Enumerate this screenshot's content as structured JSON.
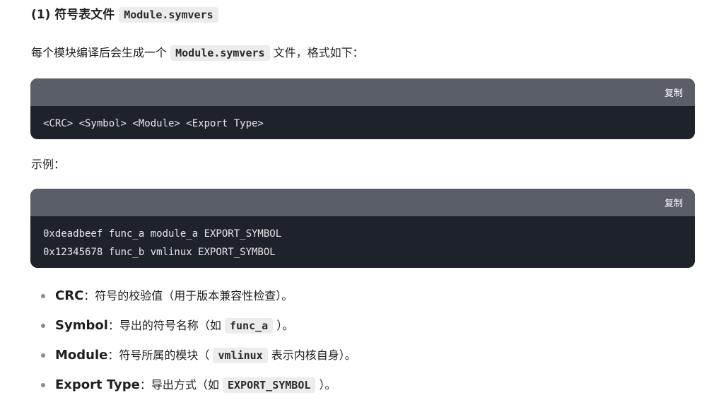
{
  "heading": {
    "prefix": "(1) 符号表文件",
    "code": "Module.symvers"
  },
  "intro": {
    "before": "每个模块编译后会生成一个",
    "code": "Module.symvers",
    "after": "文件，格式如下："
  },
  "format_block": {
    "copy_label": "复制",
    "code": "<CRC> <Symbol> <Module> <Export Type>"
  },
  "example_label": "示例：",
  "example_block": {
    "copy_label": "复制",
    "lines": [
      "0xdeadbeef func_a module_a EXPORT_SYMBOL",
      "0x12345678 func_b vmlinux EXPORT_SYMBOL"
    ]
  },
  "fields": [
    {
      "term": "CRC",
      "sep": "：",
      "before": "符号的校验值（用于版本兼容性检查）。",
      "code": "",
      "after": ""
    },
    {
      "term": "Symbol",
      "sep": "：",
      "before": "导出的符号名称（如",
      "code": "func_a",
      "after": "）。"
    },
    {
      "term": "Module",
      "sep": "：",
      "before": "符号所属的模块（",
      "code": "vmlinux",
      "after": "表示内核自身）。"
    },
    {
      "term": "Export Type",
      "sep": "：",
      "before": "导出方式（如",
      "code": "EXPORT_SYMBOL",
      "after": "）。"
    }
  ]
}
